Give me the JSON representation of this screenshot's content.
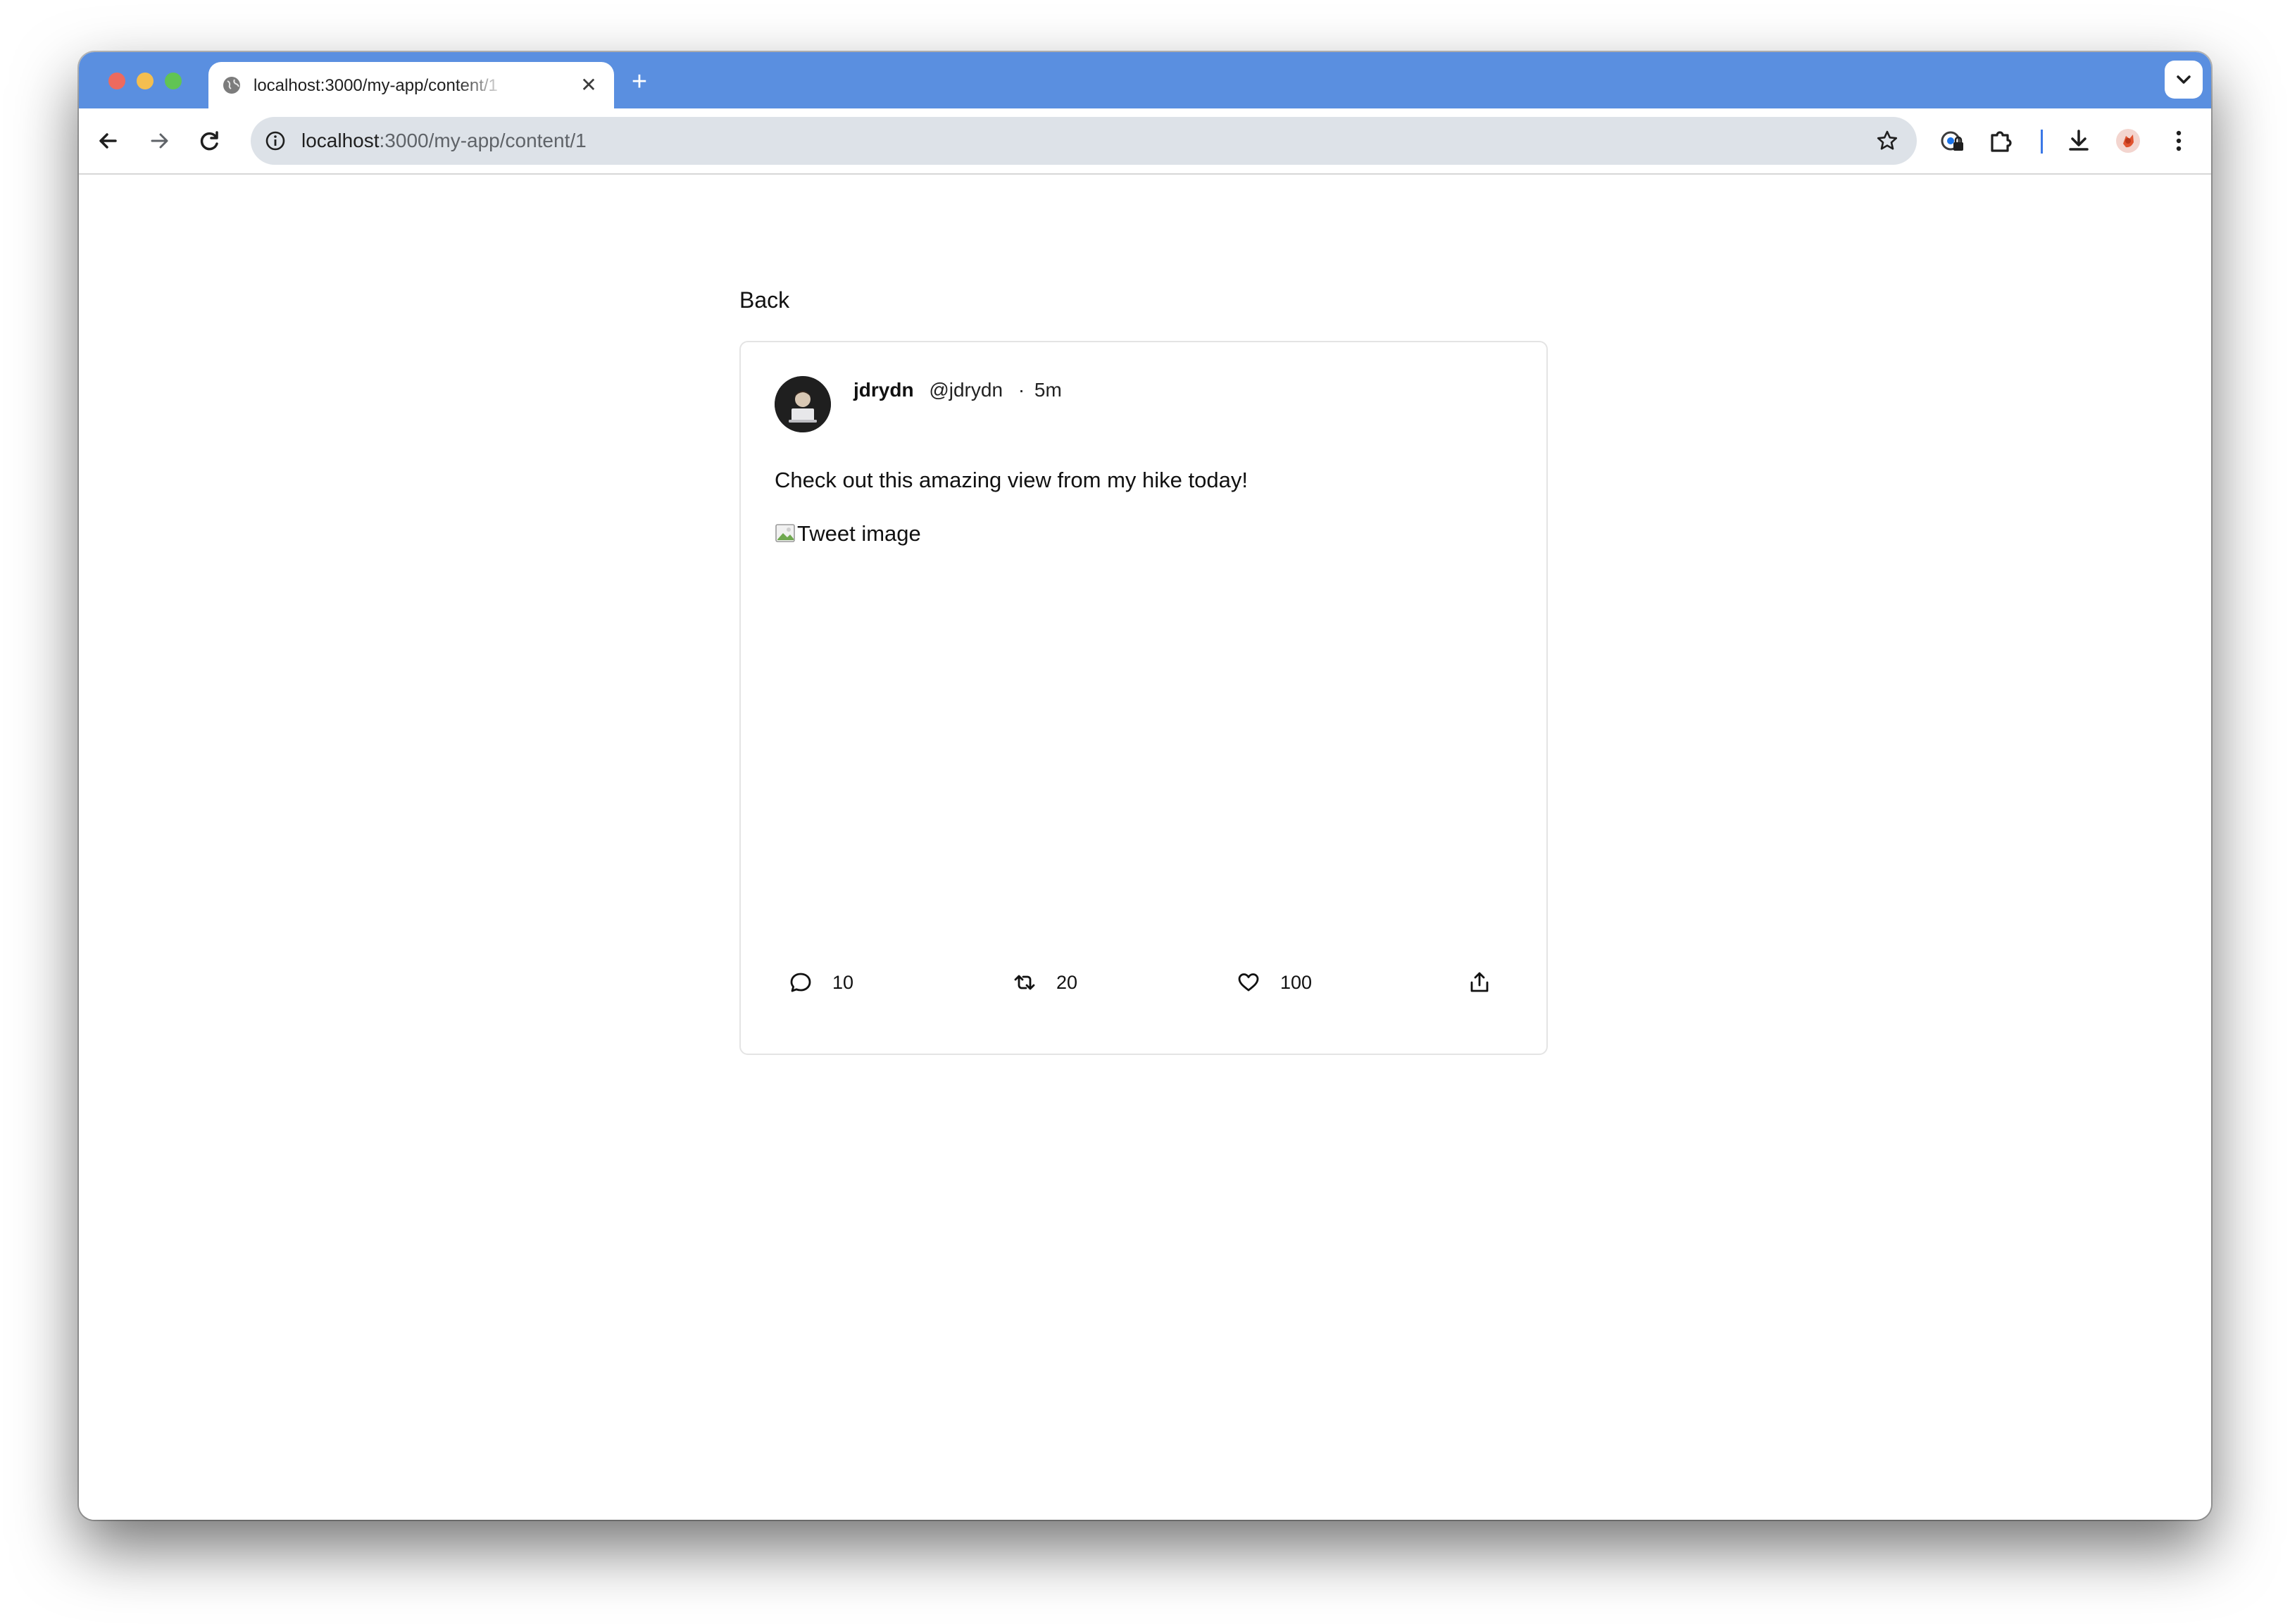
{
  "browser": {
    "tab": {
      "title": "localhost:3000/my-app/content/1",
      "close_glyph": "✕"
    },
    "new_tab_glyph": "+",
    "address_bar": {
      "host": "localhost",
      "path": ":3000/my-app/content/1"
    },
    "icons": {
      "back": "arrow-left-icon",
      "forward": "arrow-right-icon",
      "reload": "reload-icon",
      "site_info": "info-icon",
      "bookmark": "star-icon",
      "password_manager": "password-key-icon",
      "extensions": "puzzle-icon",
      "downloads": "download-icon",
      "profile": "profile-avatar-icon",
      "menu": "kebab-menu-icon",
      "tab_search": "chevron-down-icon"
    },
    "colors": {
      "tabbar": "#5a8fe0",
      "omnibox": "#dde2e8"
    }
  },
  "page": {
    "back_label": "Back",
    "tweet": {
      "author_name": "jdrydn",
      "author_handle": "@jdrydn",
      "separator": "·",
      "time": "5m",
      "text": "Check out this amazing view from my hike today!",
      "image_alt": "Tweet image",
      "stats": {
        "replies": "10",
        "retweets": "20",
        "likes": "100"
      }
    }
  }
}
